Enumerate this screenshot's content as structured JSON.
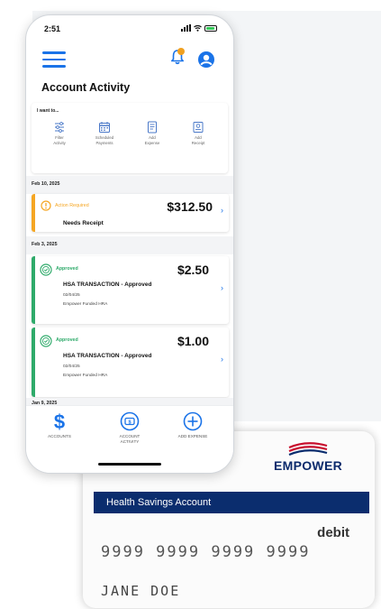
{
  "status_bar": {
    "time": "2:51"
  },
  "header": {
    "title": "Account Activity"
  },
  "quick_actions": {
    "title": "I want to...",
    "items": [
      {
        "label_1": "Filter",
        "label_2": "Activity",
        "icon": "filter-icon"
      },
      {
        "label_1": "Scheduled",
        "label_2": "Payments",
        "icon": "calendar-icon"
      },
      {
        "label_1": "Add",
        "label_2": "Expense",
        "icon": "add-expense-icon"
      },
      {
        "label_1": "Add",
        "label_2": "Receipt",
        "icon": "receipt-icon"
      }
    ]
  },
  "groups": [
    {
      "date": "Feb 10, 2025",
      "transactions": [
        {
          "status": "Action Required",
          "title": "Needs Receipt",
          "amount": "$312.50",
          "status_color": "#f5a623"
        }
      ]
    },
    {
      "date": "Feb 3, 2025",
      "transactions": [
        {
          "status": "Approved",
          "title": "HSA TRANSACTION - Approved",
          "date": "02/04/25",
          "account": "Empower Funded HRA",
          "amount": "$2.50",
          "status_color": "#2eaa6a"
        },
        {
          "status": "Approved",
          "title": "HSA TRANSACTION - Approved",
          "date": "02/04/25",
          "account": "Empower Funded HRA",
          "amount": "$1.00",
          "status_color": "#2eaa6a"
        }
      ]
    },
    {
      "date": "Jan 9, 2025",
      "transactions": []
    }
  ],
  "tab_bar": {
    "items": [
      {
        "label_1": "ACCOUNTS",
        "label_2": "",
        "icon": "dollar-icon"
      },
      {
        "label_1": "ACCOUNT",
        "label_2": "ACTIVITY",
        "icon": "account-activity-icon"
      },
      {
        "label_1": "ADD EXPENSE",
        "label_2": "",
        "icon": "plus-circle-icon"
      }
    ]
  },
  "card": {
    "brand": "EMPOWER",
    "account_type": "Health Savings Account",
    "card_type": "debit",
    "number": "9999 9999 9999 9999",
    "holder": "JANE DOE"
  },
  "colors": {
    "accent_blue": "#1a73e8",
    "warning_orange": "#f5a623",
    "approved_green": "#2eaa6a",
    "brand_navy": "#0b2d6e",
    "brand_red": "#c8102e"
  }
}
